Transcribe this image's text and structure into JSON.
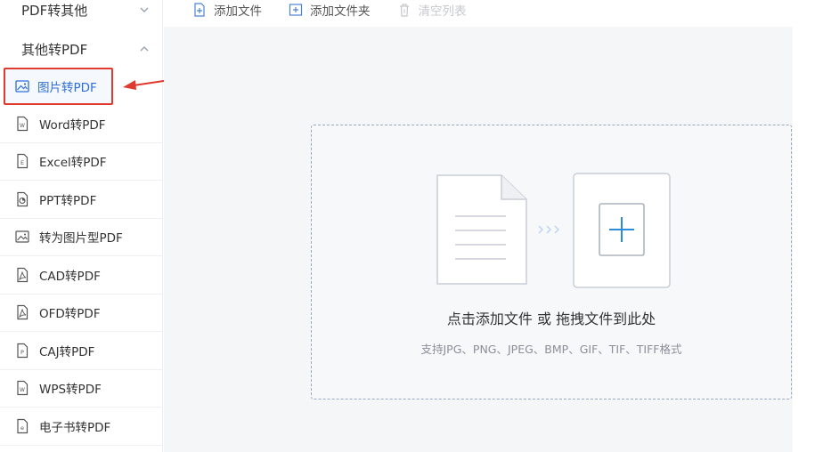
{
  "sidebar": {
    "groups": [
      {
        "label": "PDF转其他"
      },
      {
        "label": "其他转PDF"
      }
    ],
    "items": [
      {
        "label": "图片转PDF",
        "icon": "image-icon"
      },
      {
        "label": "Word转PDF",
        "icon": "word-file-icon"
      },
      {
        "label": "Excel转PDF",
        "icon": "excel-file-icon"
      },
      {
        "label": "PPT转PDF",
        "icon": "ppt-file-icon"
      },
      {
        "label": "转为图片型PDF",
        "icon": "image-icon"
      },
      {
        "label": "CAD转PDF",
        "icon": "pdf-file-icon"
      },
      {
        "label": "OFD转PDF",
        "icon": "pdf-file-icon"
      },
      {
        "label": "CAJ转PDF",
        "icon": "caj-file-icon"
      },
      {
        "label": "WPS转PDF",
        "icon": "wps-file-icon"
      },
      {
        "label": "电子书转PDF",
        "icon": "ebook-file-icon"
      }
    ]
  },
  "toolbar": {
    "add_file": "添加文件",
    "add_folder": "添加文件夹",
    "clear_list": "清空列表"
  },
  "dropzone": {
    "title": "点击添加文件 或 拖拽文件到此处",
    "subtitle": "支持JPG、PNG、JPEG、BMP、GIF、TIF、TIFF格式"
  },
  "colors": {
    "accent": "#2e6fd6",
    "annotation": "#e03a2f"
  }
}
